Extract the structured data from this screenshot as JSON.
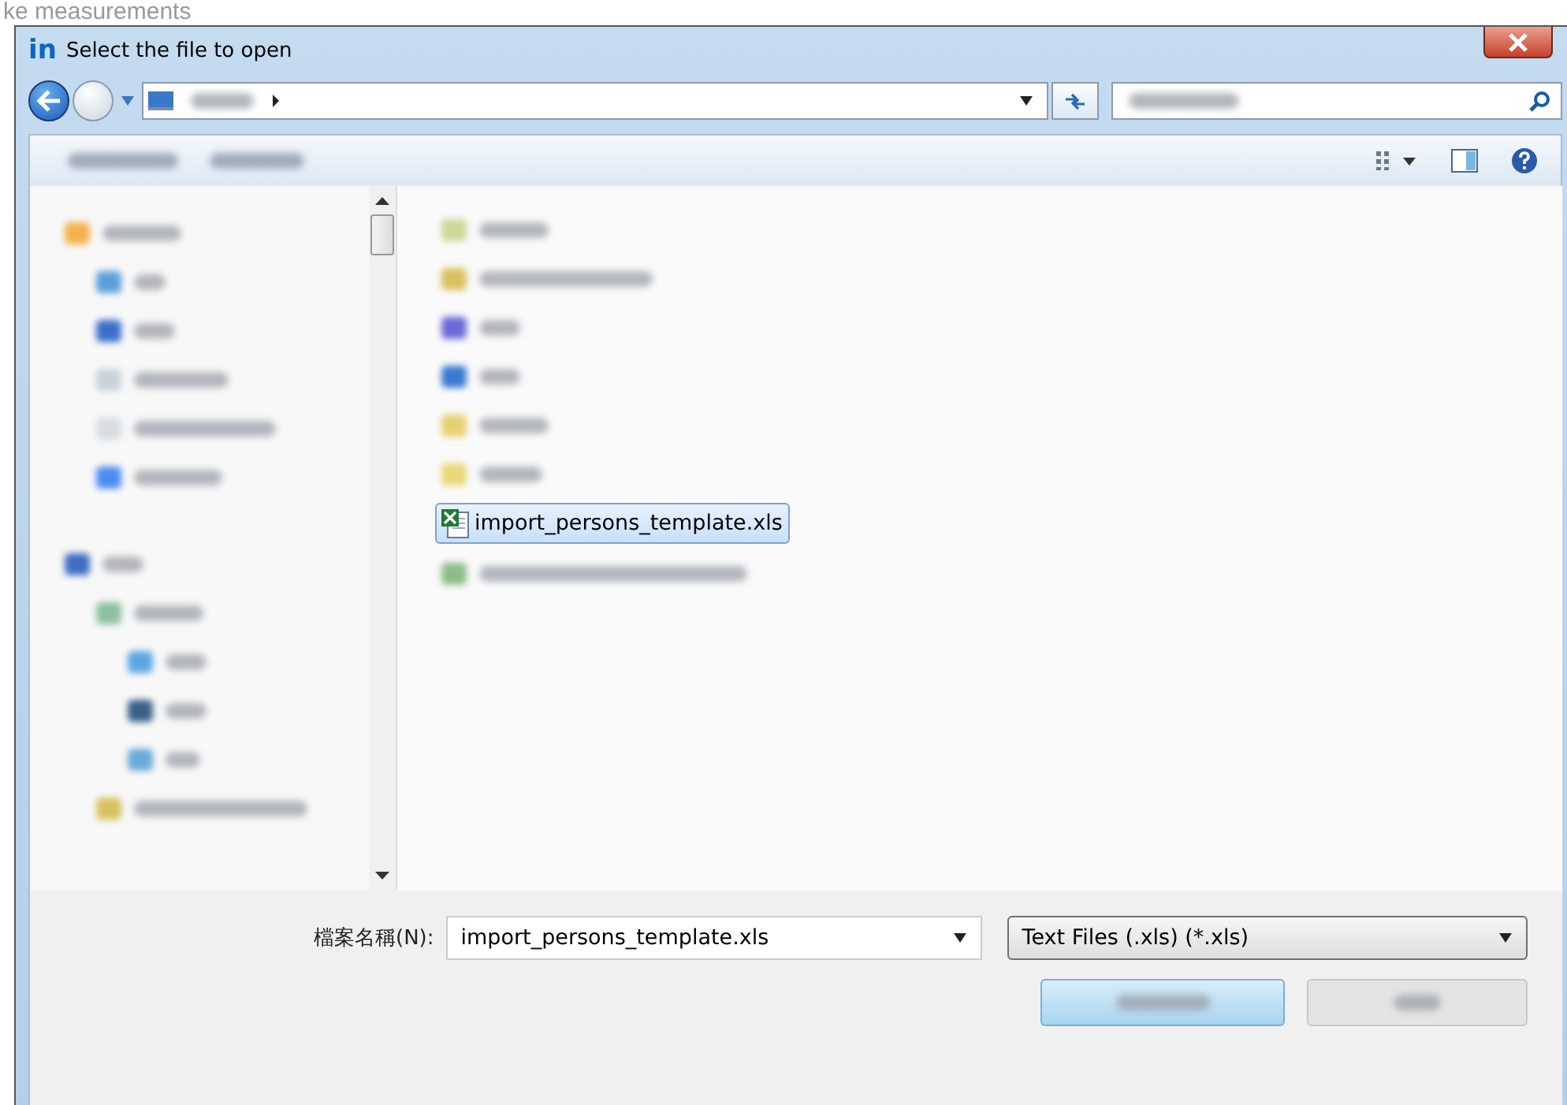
{
  "background_text": "ke measurements",
  "window": {
    "title": "Select the file to open",
    "app_mark": "in"
  },
  "files": [
    {
      "name": "import_persons_template.xls",
      "selected": true
    }
  ],
  "footer": {
    "file_name_label": "檔案名稱(N):",
    "file_name": "import_persons_template.xls",
    "file_type": "Text Files (.xls) (*.xls)"
  }
}
